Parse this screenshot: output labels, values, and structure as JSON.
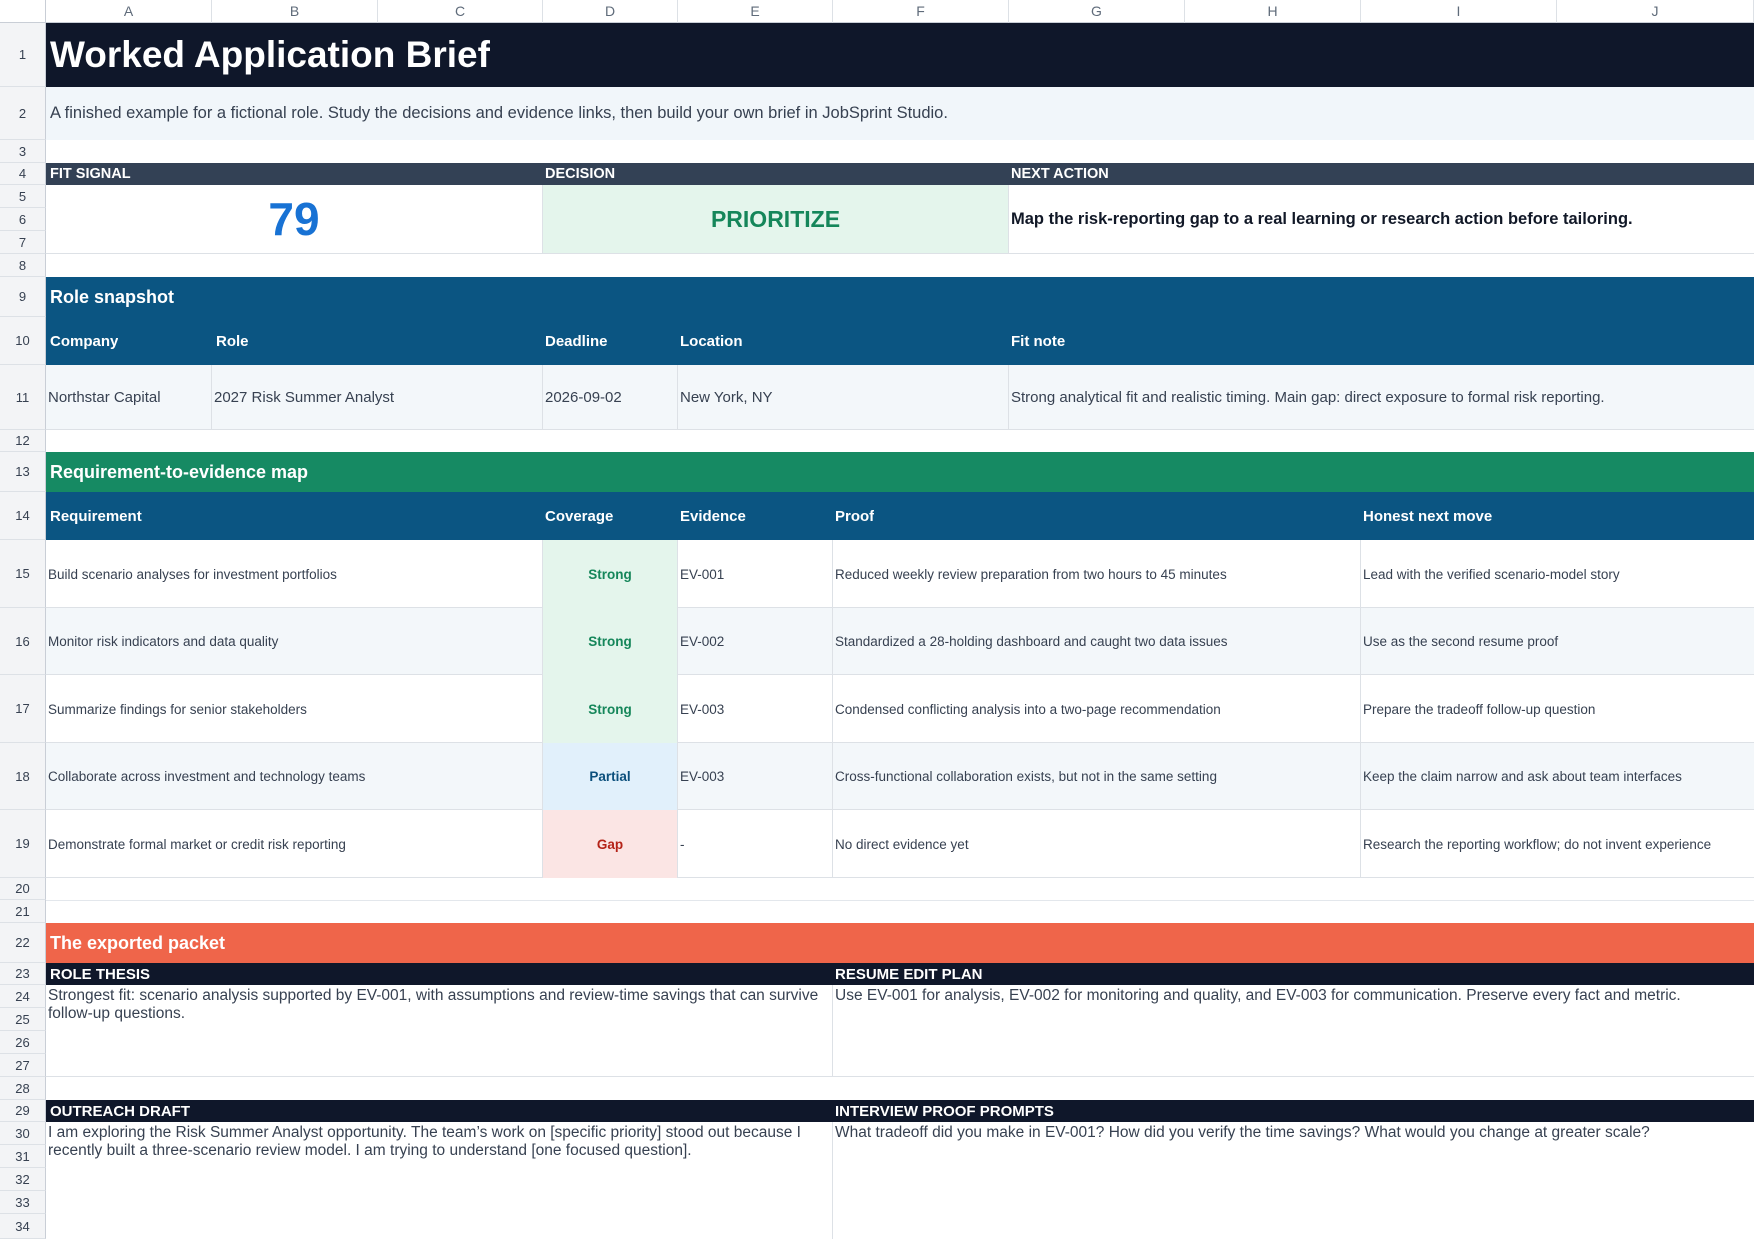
{
  "columns": [
    "A",
    "B",
    "C",
    "D",
    "E",
    "F",
    "G",
    "H",
    "I",
    "J"
  ],
  "rows": [
    "1",
    "2",
    "3",
    "4",
    "5",
    "6",
    "7",
    "8",
    "9",
    "10",
    "11",
    "12",
    "13",
    "14",
    "15",
    "16",
    "17",
    "18",
    "19",
    "20",
    "21",
    "22",
    "23",
    "24",
    "25",
    "26",
    "27",
    "28",
    "29",
    "30",
    "31",
    "32",
    "33",
    "34"
  ],
  "title": "Worked Application Brief",
  "subtitle": "A finished example for a fictional role. Study the decisions and evidence links, then build your own brief in JobSprint Studio.",
  "summary": {
    "fit_label": "FIT SIGNAL",
    "fit_value": "79",
    "decision_label": "DECISION",
    "decision_value": "PRIORITIZE",
    "next_label": "NEXT ACTION",
    "next_value": "Map the risk-reporting gap to a real learning or research action before tailoring."
  },
  "snapshot": {
    "heading": "Role snapshot",
    "headers": {
      "company": "Company",
      "role": "Role",
      "deadline": "Deadline",
      "location": "Location",
      "fit_note": "Fit note"
    },
    "row": {
      "company": "Northstar Capital",
      "role": "2027 Risk Summer Analyst",
      "deadline": "2026-09-02",
      "location": "New York, NY",
      "fit_note": "Strong analytical fit and realistic timing. Main gap: direct exposure to formal risk reporting."
    }
  },
  "map": {
    "heading": "Requirement-to-evidence map",
    "headers": {
      "requirement": "Requirement",
      "coverage": "Coverage",
      "evidence": "Evidence",
      "proof": "Proof",
      "next": "Honest next move"
    },
    "rows": [
      {
        "requirement": "Build scenario analyses for investment portfolios",
        "coverage": "Strong",
        "evidence": "EV-001",
        "proof": "Reduced weekly review preparation from two hours to 45 minutes",
        "next": "Lead with the verified scenario-model story"
      },
      {
        "requirement": "Monitor risk indicators and data quality",
        "coverage": "Strong",
        "evidence": "EV-002",
        "proof": "Standardized a 28-holding dashboard and caught two data issues",
        "next": "Use as the second resume proof"
      },
      {
        "requirement": "Summarize findings for senior stakeholders",
        "coverage": "Strong",
        "evidence": "EV-003",
        "proof": "Condensed conflicting analysis into a two-page recommendation",
        "next": "Prepare the tradeoff follow-up question"
      },
      {
        "requirement": "Collaborate across investment and technology teams",
        "coverage": "Partial",
        "evidence": "EV-003",
        "proof": "Cross-functional collaboration exists, but not in the same setting",
        "next": "Keep the claim narrow and ask about team interfaces"
      },
      {
        "requirement": "Demonstrate formal market or credit risk reporting",
        "coverage": "Gap",
        "evidence": "-",
        "proof": "No direct evidence yet",
        "next": "Research the reporting workflow; do not invent experience"
      }
    ]
  },
  "packet": {
    "heading": "The exported packet",
    "role_thesis_label": "ROLE THESIS",
    "role_thesis_text": "Strongest fit: scenario analysis supported by EV-001, with assumptions and review-time savings that can survive follow-up questions.",
    "resume_label": "RESUME EDIT PLAN",
    "resume_text": "Use EV-001 for analysis, EV-002 for monitoring and quality, and EV-003 for communication. Preserve every fact and metric.",
    "outreach_label": "OUTREACH DRAFT",
    "outreach_text": "I am exploring the Risk Summer Analyst opportunity. The team’s work on [specific priority] stood out because I recently built a three-scenario review model. I am trying to understand [one focused question].",
    "interview_label": "INTERVIEW PROOF PROMPTS",
    "interview_text": "What tradeoff did you make in EV-001? How did you verify the time savings? What would you change at greater scale?"
  },
  "colors": {
    "title_bg": "#0f172a",
    "summary_header_bg": "#334155",
    "snapshot_bg": "#0b5582",
    "map_heading_bg": "#168a63",
    "packet_heading_bg": "#ef654a",
    "strong_fg": "#15865a",
    "strong_bg": "#e4f5ec",
    "partial_fg": "#0b4f7c",
    "partial_bg": "#e1f0fb",
    "gap_fg": "#b42318",
    "gap_bg": "#fbe5e4",
    "fit_value": "#1872d4"
  }
}
